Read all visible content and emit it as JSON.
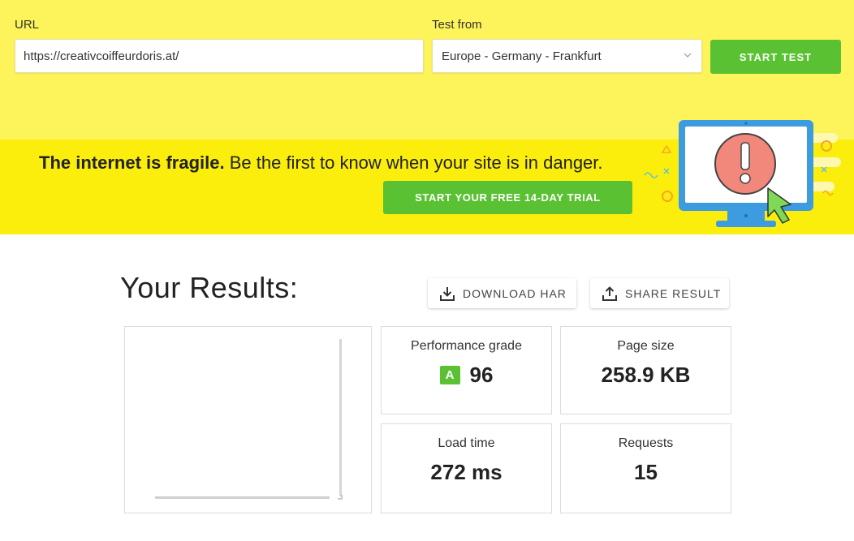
{
  "form": {
    "url_label": "URL",
    "url_value": "https://creativcoiffeurdoris.at/",
    "test_from_label": "Test from",
    "test_from_value": "Europe - Germany - Frankfurt",
    "start_label": "START TEST"
  },
  "banner": {
    "headline_bold": "The internet is fragile.",
    "headline_rest": " Be the first to know when your site is in danger.",
    "trial_label": "START YOUR FREE 14-DAY TRIAL",
    "art_icon": "monitor-alert-icon"
  },
  "results": {
    "title": "Your Results:",
    "download_label": "DOWNLOAD HAR",
    "share_label": "SHARE RESULT",
    "metrics": {
      "grade_label": "Performance grade",
      "grade_letter": "A",
      "grade_value": "96",
      "size_label": "Page size",
      "size_value": "258.9 KB",
      "load_label": "Load time",
      "load_value": "272 ms",
      "requests_label": "Requests",
      "requests_value": "15"
    }
  },
  "colors": {
    "form_bg": "#fdf35a",
    "banner_bg": "#fcee0c",
    "accent_green": "#5ac232",
    "monitor_blue": "#3d9be0",
    "alert_red": "#f2877b"
  }
}
